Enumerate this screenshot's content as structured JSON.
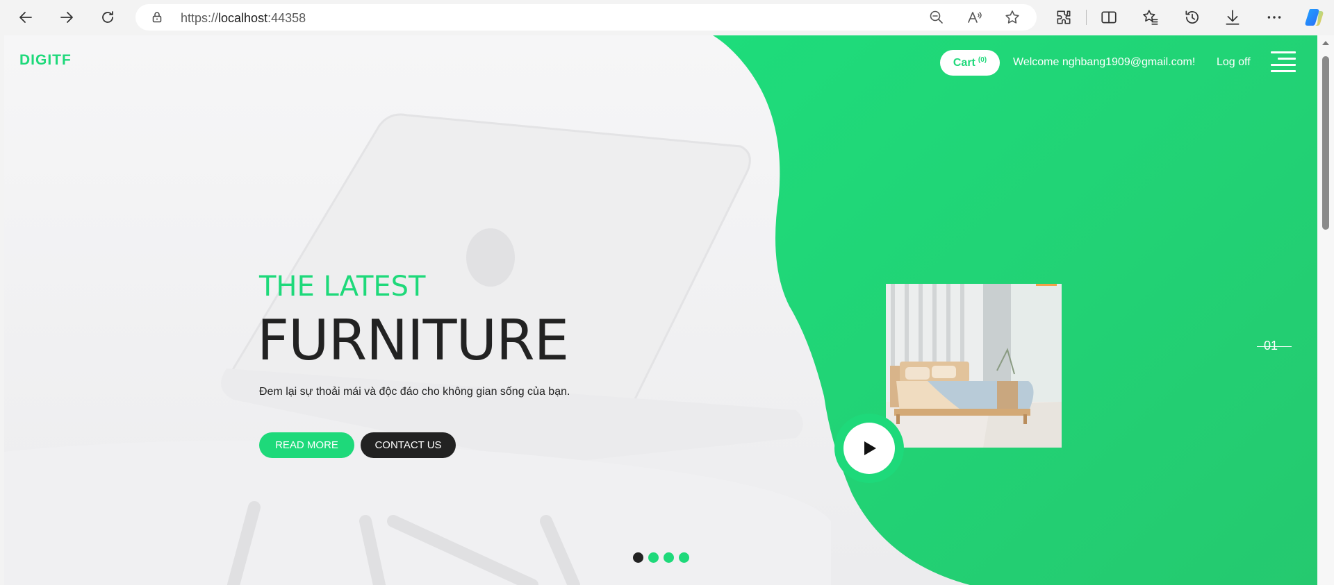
{
  "browser": {
    "url_scheme": "https://",
    "url_host": "localhost",
    "url_port": ":44358"
  },
  "site": {
    "logo": "DIGITF",
    "cart_label": "Cart",
    "cart_count": "(0)",
    "welcome": "Welcome nghbang1909@gmail.com!",
    "logoff": "Log off"
  },
  "hero": {
    "subtitle": "THE LATEST",
    "title": "FURNITURE",
    "tagline": "Đem lại sự thoải mái và độc đáo cho không gian sống của bạn.",
    "read_more": "READ MORE",
    "contact_us": "CONTACT US",
    "slide_number": "01",
    "slide_count": 4,
    "active_slide": 1
  },
  "colors": {
    "accent": "#1ed97a",
    "dark": "#222222"
  }
}
